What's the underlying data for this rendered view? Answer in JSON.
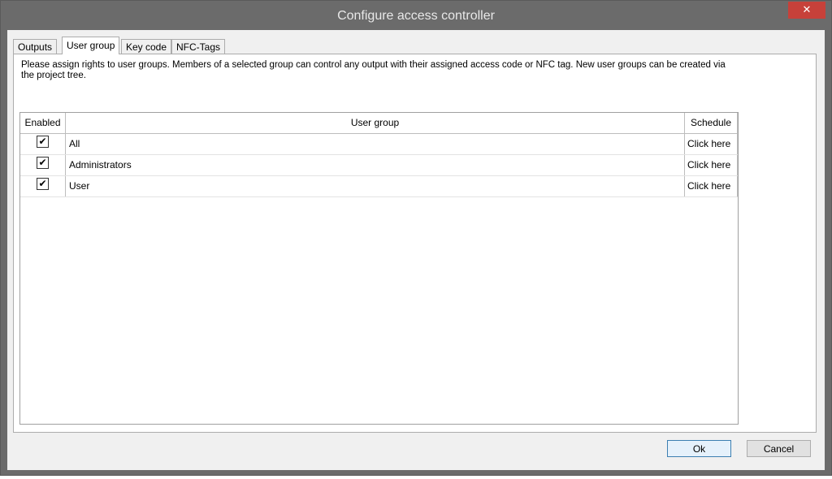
{
  "window": {
    "title": "Configure access controller",
    "close_glyph": "✕"
  },
  "tabs": [
    {
      "label": "Outputs",
      "active": false
    },
    {
      "label": "User group",
      "active": true
    },
    {
      "label": "Key code",
      "active": false
    },
    {
      "label": "NFC-Tags",
      "active": false
    }
  ],
  "panel": {
    "description": "Please assign rights to user groups. Members of a selected group can control any output with their assigned access code or NFC tag. New user groups can be created via the project tree."
  },
  "grid": {
    "columns": {
      "enabled": "Enabled",
      "user_group": "User group",
      "schedule": "Schedule"
    },
    "rows": [
      {
        "enabled": true,
        "check_glyph": "✔",
        "user_group": "All",
        "schedule": "Click here"
      },
      {
        "enabled": true,
        "check_glyph": "✔",
        "user_group": "Administrators",
        "schedule": "Click here"
      },
      {
        "enabled": true,
        "check_glyph": "✔",
        "user_group": "User",
        "schedule": "Click here"
      }
    ]
  },
  "buttons": {
    "ok": "Ok",
    "cancel": "Cancel"
  }
}
